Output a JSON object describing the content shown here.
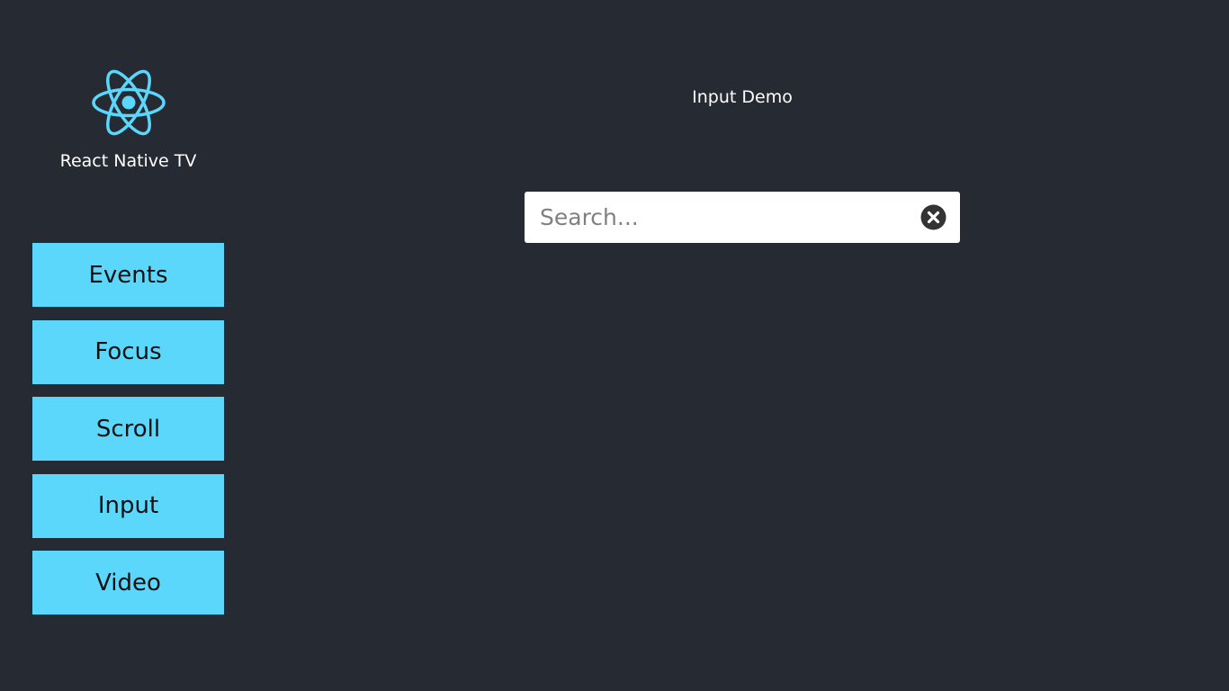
{
  "sidebar": {
    "logo_icon": "react-logo-icon",
    "app_title": "React Native TV",
    "items": [
      {
        "label": "Events"
      },
      {
        "label": "Focus"
      },
      {
        "label": "Scroll"
      },
      {
        "label": "Input"
      },
      {
        "label": "Video"
      }
    ]
  },
  "main": {
    "title": "Input Demo",
    "search": {
      "value": "",
      "placeholder": "Search...",
      "clear_icon": "clear-circle-icon"
    }
  },
  "colors": {
    "background": "#262a33",
    "accent": "#5bd7fb",
    "text_light": "#ffffff",
    "text_dark": "#111111"
  }
}
